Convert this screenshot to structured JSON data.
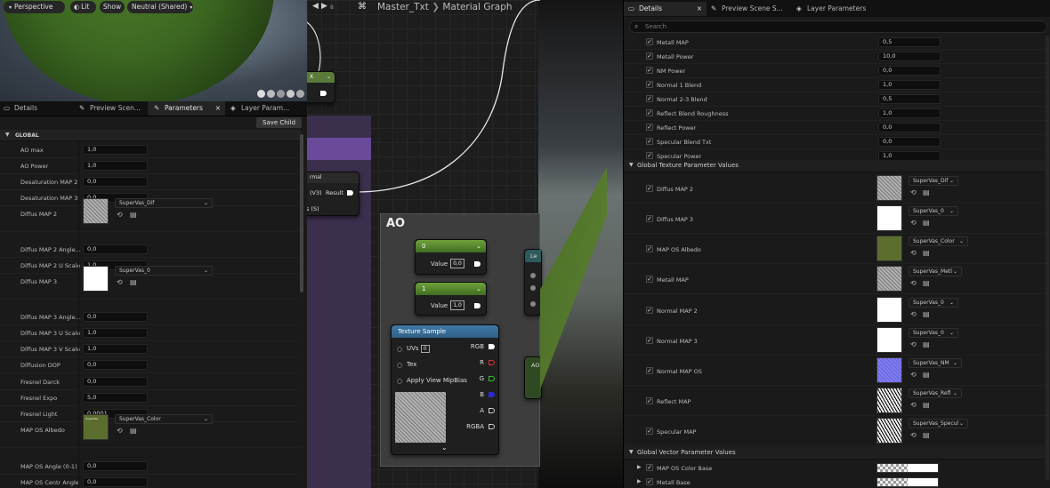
{
  "viewport": {
    "buttons": [
      "Perspective",
      "Lit",
      "Show",
      "Neutral (Shared)"
    ]
  },
  "left_tabs": [
    "Details",
    "Preview Scen...",
    "Parameters",
    "Layer Param..."
  ],
  "save_child": "Save Child",
  "global_header": "GLOBAL",
  "params": [
    {
      "label": "AO max",
      "value": "1,0"
    },
    {
      "label": "AO Power",
      "value": "1,0"
    },
    {
      "label": "Desaturation MAP 2",
      "value": "0,0"
    },
    {
      "label": "Desaturation MAP 3",
      "value": "0,0"
    },
    {
      "label": "Diffus MAP 2",
      "texture": "SuperVas_Dif"
    },
    {
      "label": "Diffus MAP 2 Angle...",
      "value": "0,0"
    },
    {
      "label": "Diffus MAP 2 U Scale",
      "value": "1,0"
    },
    {
      "label": "Diffus MAP 3",
      "texture": "SuperVas_0"
    },
    {
      "label": "Diffus MAP 3 Angle...",
      "value": "0,0"
    },
    {
      "label": "Diffus MAP 3 U Scale",
      "value": "1,0"
    },
    {
      "label": "Diffus MAP 3 V Scale",
      "value": "1,0"
    },
    {
      "label": "Diffusion DOP",
      "value": "0,0"
    },
    {
      "label": "Fresnel Darck",
      "value": "0,0"
    },
    {
      "label": "Fresnel Expo",
      "value": "5,0"
    },
    {
      "label": "Fresnel Light",
      "value": "0,0001"
    },
    {
      "label": "MAP OS Albedo",
      "texture": "SuperVas_Color",
      "thumb_text": "SuperVas"
    },
    {
      "label": "MAP OS Angle (0-1)",
      "value": "0,0"
    },
    {
      "label": "MAP OS Centr Angle",
      "value": "0,0"
    }
  ],
  "graph": {
    "title": "Master_Txt",
    "subtitle": "Material Graph",
    "nav_value": "8",
    "top_node_label": "X",
    "result_node": {
      "header": "rmal",
      "v3": "(V3)",
      "result": "Result",
      "s": "s (S)"
    },
    "comment_title": "AO",
    "const1": {
      "header": "0",
      "label": "Value",
      "value": "0,0"
    },
    "const2": {
      "header": "1",
      "label": "Value",
      "value": "1,0"
    },
    "lerp_header": "Le",
    "ao_node_text": "AO",
    "texture_sample": {
      "header": "Texture Sample",
      "uvs": "UVs",
      "uvs_value": "0",
      "tex": "Tex",
      "mip": "Apply View MipBias",
      "outputs": [
        "RGB",
        "R",
        "G",
        "B",
        "A",
        "RGBA"
      ]
    }
  },
  "right_tabs": [
    "Details",
    "Preview Scene S...",
    "Layer Parameters"
  ],
  "search_placeholder": "Search",
  "scalar_params": [
    {
      "label": "Metall MAP",
      "value": "0,5"
    },
    {
      "label": "Metall Power",
      "value": "10,0"
    },
    {
      "label": "NM Power",
      "value": "0,0"
    },
    {
      "label": "Normal 1 Blend",
      "value": "1,0"
    },
    {
      "label": "Normal 2-3 Blend",
      "value": "0,5"
    },
    {
      "label": "Reflect Blend Roughness",
      "value": "1,0"
    },
    {
      "label": "Reflect Power",
      "value": "0,0"
    },
    {
      "label": "Specular Blend Txt",
      "value": "0,0"
    },
    {
      "label": "Specular Power",
      "value": "1,0"
    }
  ],
  "texture_section": "Global Texture Parameter Values",
  "texture_params": [
    {
      "label": "Diffus MAP 2",
      "texture": "SuperVas_Dif"
    },
    {
      "label": "Diffus MAP 3",
      "texture": "SuperVas_0"
    },
    {
      "label": "MAP OS Albedo",
      "texture": "SuperVas_Color"
    },
    {
      "label": "Metall MAP",
      "texture": "SuperVas_Metl"
    },
    {
      "label": "Normal MAP 2",
      "texture": "SuperVas_0"
    },
    {
      "label": "Normal MAP 3",
      "texture": "SuperVas_0"
    },
    {
      "label": "Normal MAP OS",
      "texture": "SuperVas_NM"
    },
    {
      "label": "Reflect MAP",
      "texture": "SuperVas_Refl"
    },
    {
      "label": "Specular MAP",
      "texture": "SuperVas_Specul"
    }
  ],
  "vector_section": "Global Vector Parameter Values",
  "vector_params": [
    {
      "label": "MAP OS Color Base"
    },
    {
      "label": "Metall Base"
    }
  ],
  "colors": {
    "accent": "#4a7a2a",
    "node_blue": "#2f5f86",
    "comment": "#6a4a9a",
    "bg": "#151515"
  }
}
